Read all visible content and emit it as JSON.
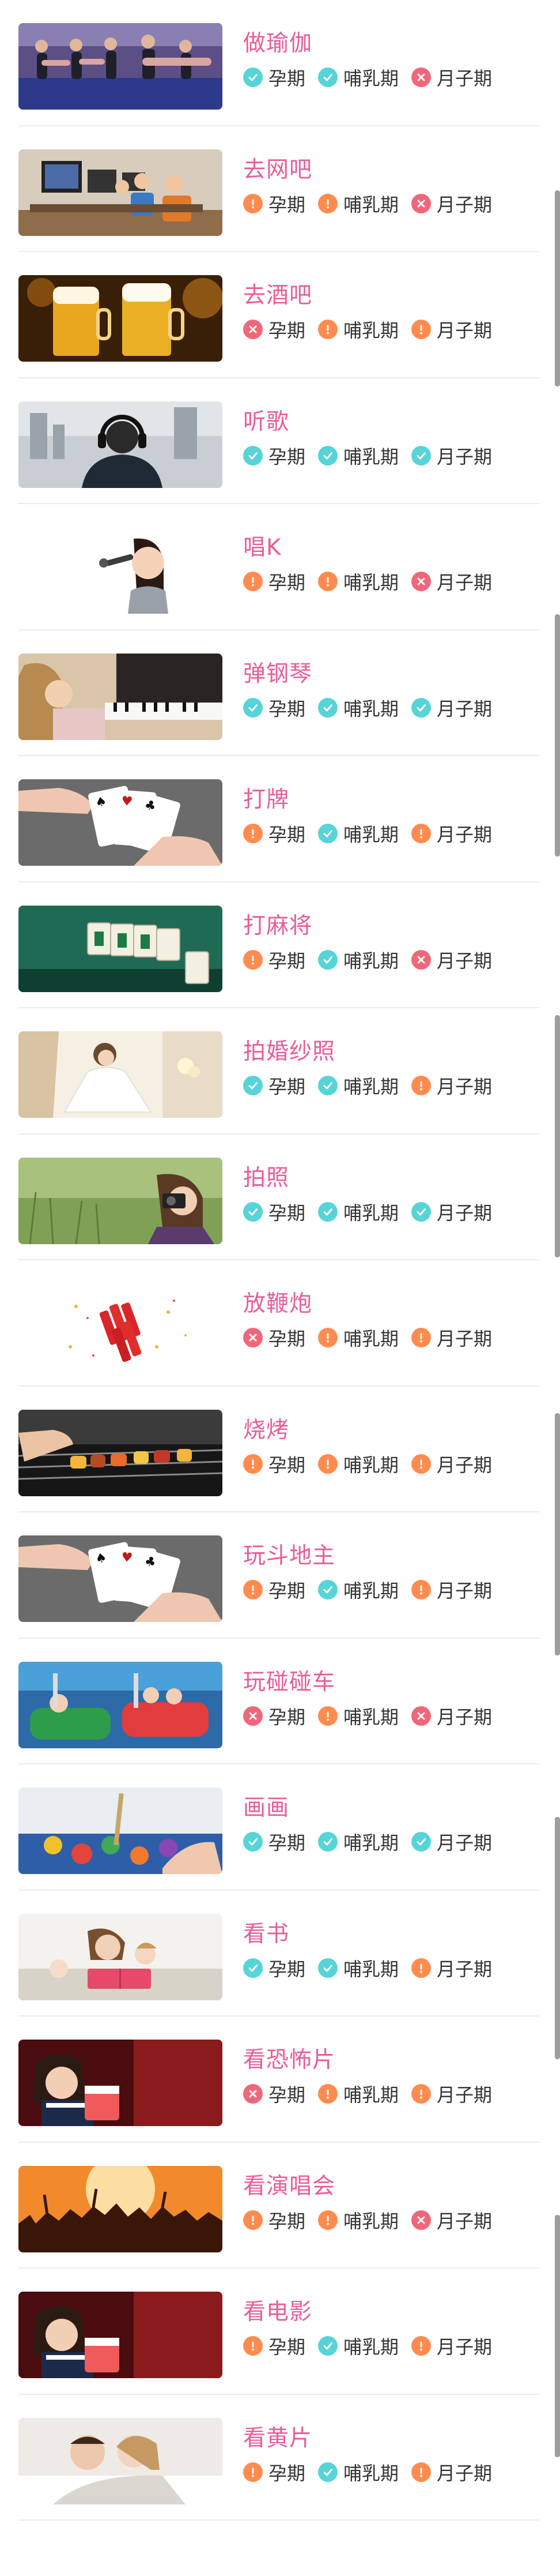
{
  "colors": {
    "title": "#e85d99",
    "ok": "#56d4d8",
    "caution": "#ff8b4f",
    "no": "#f0677a",
    "divider": "#ececec"
  },
  "status_icons": {
    "ok": "check-icon",
    "caution": "exclamation-icon",
    "no": "cross-icon"
  },
  "items": [
    {
      "title": "做瑜伽",
      "thumb": "yoga",
      "tags": [
        {
          "label": "孕期",
          "status": "ok"
        },
        {
          "label": "哺乳期",
          "status": "ok"
        },
        {
          "label": "月子期",
          "status": "no"
        }
      ]
    },
    {
      "title": "去网吧",
      "thumb": "internet-cafe",
      "tags": [
        {
          "label": "孕期",
          "status": "caution"
        },
        {
          "label": "哺乳期",
          "status": "caution"
        },
        {
          "label": "月子期",
          "status": "no"
        }
      ]
    },
    {
      "title": "去酒吧",
      "thumb": "beer",
      "tags": [
        {
          "label": "孕期",
          "status": "no"
        },
        {
          "label": "哺乳期",
          "status": "caution"
        },
        {
          "label": "月子期",
          "status": "caution"
        }
      ]
    },
    {
      "title": "听歌",
      "thumb": "headphones",
      "tags": [
        {
          "label": "孕期",
          "status": "ok"
        },
        {
          "label": "哺乳期",
          "status": "ok"
        },
        {
          "label": "月子期",
          "status": "ok"
        }
      ]
    },
    {
      "title": "唱K",
      "thumb": "karaoke",
      "tags": [
        {
          "label": "孕期",
          "status": "caution"
        },
        {
          "label": "哺乳期",
          "status": "caution"
        },
        {
          "label": "月子期",
          "status": "no"
        }
      ]
    },
    {
      "title": "弹钢琴",
      "thumb": "piano",
      "tags": [
        {
          "label": "孕期",
          "status": "ok"
        },
        {
          "label": "哺乳期",
          "status": "ok"
        },
        {
          "label": "月子期",
          "status": "ok"
        }
      ]
    },
    {
      "title": "打牌",
      "thumb": "cards",
      "tags": [
        {
          "label": "孕期",
          "status": "caution"
        },
        {
          "label": "哺乳期",
          "status": "ok"
        },
        {
          "label": "月子期",
          "status": "caution"
        }
      ]
    },
    {
      "title": "打麻将",
      "thumb": "mahjong",
      "tags": [
        {
          "label": "孕期",
          "status": "caution"
        },
        {
          "label": "哺乳期",
          "status": "ok"
        },
        {
          "label": "月子期",
          "status": "no"
        }
      ]
    },
    {
      "title": "拍婚纱照",
      "thumb": "wedding",
      "tags": [
        {
          "label": "孕期",
          "status": "ok"
        },
        {
          "label": "哺乳期",
          "status": "ok"
        },
        {
          "label": "月子期",
          "status": "caution"
        }
      ]
    },
    {
      "title": "拍照",
      "thumb": "camera",
      "tags": [
        {
          "label": "孕期",
          "status": "ok"
        },
        {
          "label": "哺乳期",
          "status": "ok"
        },
        {
          "label": "月子期",
          "status": "ok"
        }
      ]
    },
    {
      "title": "放鞭炮",
      "thumb": "firecracker",
      "tags": [
        {
          "label": "孕期",
          "status": "no"
        },
        {
          "label": "哺乳期",
          "status": "caution"
        },
        {
          "label": "月子期",
          "status": "caution"
        }
      ]
    },
    {
      "title": "烧烤",
      "thumb": "bbq",
      "tags": [
        {
          "label": "孕期",
          "status": "caution"
        },
        {
          "label": "哺乳期",
          "status": "caution"
        },
        {
          "label": "月子期",
          "status": "caution"
        }
      ]
    },
    {
      "title": "玩斗地主",
      "thumb": "cards",
      "tags": [
        {
          "label": "孕期",
          "status": "caution"
        },
        {
          "label": "哺乳期",
          "status": "ok"
        },
        {
          "label": "月子期",
          "status": "caution"
        }
      ]
    },
    {
      "title": "玩碰碰车",
      "thumb": "bumper-car",
      "tags": [
        {
          "label": "孕期",
          "status": "no"
        },
        {
          "label": "哺乳期",
          "status": "caution"
        },
        {
          "label": "月子期",
          "status": "no"
        }
      ]
    },
    {
      "title": "画画",
      "thumb": "painting",
      "tags": [
        {
          "label": "孕期",
          "status": "ok"
        },
        {
          "label": "哺乳期",
          "status": "ok"
        },
        {
          "label": "月子期",
          "status": "ok"
        }
      ]
    },
    {
      "title": "看书",
      "thumb": "reading",
      "tags": [
        {
          "label": "孕期",
          "status": "ok"
        },
        {
          "label": "哺乳期",
          "status": "ok"
        },
        {
          "label": "月子期",
          "status": "caution"
        }
      ]
    },
    {
      "title": "看恐怖片",
      "thumb": "cinema",
      "tags": [
        {
          "label": "孕期",
          "status": "no"
        },
        {
          "label": "哺乳期",
          "status": "caution"
        },
        {
          "label": "月子期",
          "status": "caution"
        }
      ]
    },
    {
      "title": "看演唱会",
      "thumb": "concert",
      "tags": [
        {
          "label": "孕期",
          "status": "caution"
        },
        {
          "label": "哺乳期",
          "status": "caution"
        },
        {
          "label": "月子期",
          "status": "no"
        }
      ]
    },
    {
      "title": "看电影",
      "thumb": "cinema",
      "tags": [
        {
          "label": "孕期",
          "status": "caution"
        },
        {
          "label": "哺乳期",
          "status": "ok"
        },
        {
          "label": "月子期",
          "status": "caution"
        }
      ]
    },
    {
      "title": "看黄片",
      "thumb": "couple",
      "tags": [
        {
          "label": "孕期",
          "status": "caution"
        },
        {
          "label": "哺乳期",
          "status": "ok"
        },
        {
          "label": "月子期",
          "status": "caution"
        }
      ]
    }
  ]
}
